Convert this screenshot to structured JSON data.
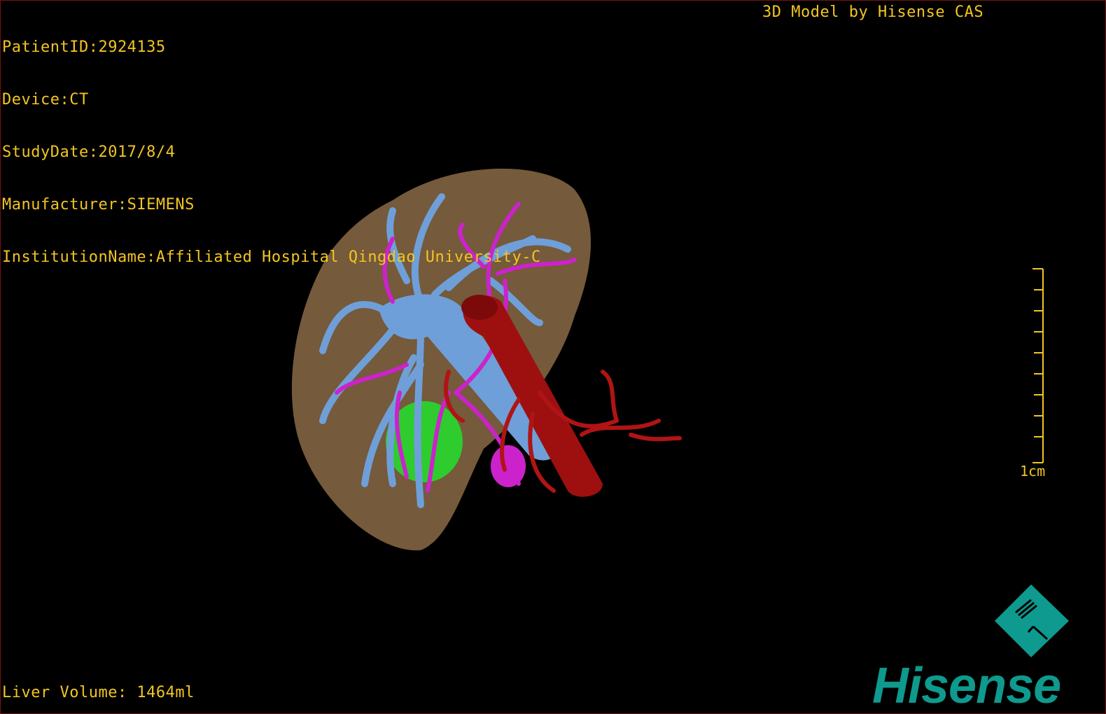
{
  "patient_info": {
    "patient_id": "PatientID:2924135",
    "device": "Device:CT",
    "study_date": "StudyDate:2017/8/4",
    "manufacturer": "Manufacturer:SIEMENS",
    "institution": "InstitutionName:Affiliated Hospital Qingdao University-C"
  },
  "model_credit": "3D Model by Hisense CAS",
  "liver_volume": "Liver Volume: 1464ml",
  "scale_bar": {
    "label": "1cm"
  },
  "logo": {
    "wordmark": "Hisense",
    "mark_icon": "hisense-diamond-logo-icon"
  },
  "colors": {
    "overlay_text": "#f2c522",
    "liver": "#8a6a45",
    "portal_vein": "#6f9fd8",
    "hepatic_artery_branches": "#cc22cc",
    "aorta": "#9e1010",
    "gallbladder": "#2ecc2e",
    "logo": "#0e9a8e"
  }
}
